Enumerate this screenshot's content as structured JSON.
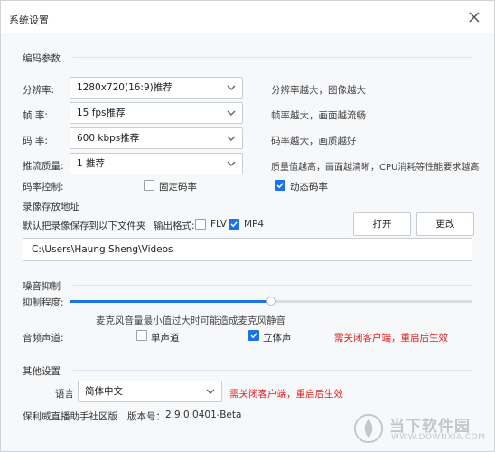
{
  "window": {
    "title": "系统设置"
  },
  "encode": {
    "section": "编码参数",
    "resolution": {
      "label": "分辨率:",
      "value": "1280x720(16:9)推荐",
      "hint": "分辨率越大，图像越大"
    },
    "framerate": {
      "label": "帧    率:",
      "value": "15 fps推荐",
      "hint": "帧率越大，画面越流畅"
    },
    "bitrate": {
      "label": "码    率:",
      "value": "600 kbps推荐",
      "hint": "码率越大，画质越好"
    },
    "quality": {
      "label": "推流质量:",
      "value": "1 推荐",
      "hint": "质量值越高，画面越清晰，CPU消耗等性能要求越高"
    },
    "rate_control": {
      "label": "码率控制:",
      "fixed_label": "固定码率",
      "fixed_checked": false,
      "dynamic_label": "动态码率",
      "dynamic_checked": true
    }
  },
  "recording": {
    "section": "录像存放地址",
    "save_text": "默认把录像保存到以下文件夹",
    "format_label": "输出格式:",
    "flv_label": "FLV",
    "flv_checked": false,
    "mp4_label": "MP4",
    "mp4_checked": true,
    "open_button": "打开",
    "change_button": "更改",
    "path": "C:\\Users\\Haung Sheng\\Videos"
  },
  "noise": {
    "section": "噪音抑制",
    "level_label": "抑制程度:",
    "level": 0.5,
    "warning": "麦克风音量最小值过大时可能造成麦克风静音",
    "channel_label": "音频声道:",
    "mono_label": "单声道",
    "mono_checked": false,
    "stereo_label": "立体声",
    "stereo_checked": true,
    "restart_note": "需关闭客户端，重启后生效"
  },
  "other": {
    "section": "其他设置",
    "language_label": "语言",
    "language_value": "简体中文",
    "restart_note": "需关闭客户端，重启后生效",
    "edition": "保利威直播助手社区版",
    "version_label": "版本号：",
    "version": "2.9.0.0401-Beta"
  },
  "watermark": {
    "text": "当下软件园",
    "sub": "WWW.DOWNXIA.COM"
  },
  "colors": {
    "accent": "#1a73e8",
    "warning": "#e02020"
  }
}
